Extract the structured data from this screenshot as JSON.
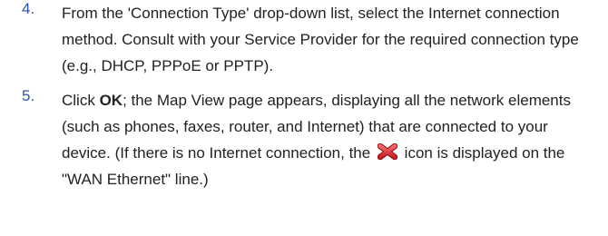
{
  "steps": [
    {
      "number": "4.",
      "text": "From the 'Connection Type' drop-down list, select the Internet connection method. Consult with your Service Provider for the required connection type (e.g., DHCP, PPPoE or PPTP)."
    },
    {
      "number": "5.",
      "text_before_bold": "Click ",
      "bold": "OK",
      "text_after_bold": "; the Map View page appears, displaying all the network elements (such as phones, faxes, router, and Internet) that are connected to your device. (If there is no Internet connection, the ",
      "icon": "red-x-icon",
      "text_after_icon": " icon is displayed on the \"WAN Ethernet\" line.)"
    }
  ],
  "colors": {
    "step_number": "#2e56a3",
    "body_text": "#222222",
    "icon_red": "#e0343a"
  }
}
